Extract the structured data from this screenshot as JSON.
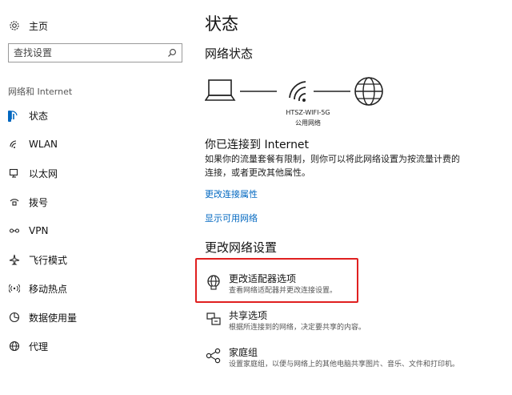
{
  "sidebar": {
    "home_label": "主页",
    "search_placeholder": "查找设置",
    "section_label": "网络和 Internet",
    "items": [
      {
        "label": "状态",
        "icon": "status-icon",
        "active": true
      },
      {
        "label": "WLAN",
        "icon": "wifi-icon"
      },
      {
        "label": "以太网",
        "icon": "ethernet-icon"
      },
      {
        "label": "拨号",
        "icon": "dialup-icon"
      },
      {
        "label": "VPN",
        "icon": "vpn-icon"
      },
      {
        "label": "飞行模式",
        "icon": "airplane-icon"
      },
      {
        "label": "移动热点",
        "icon": "hotspot-icon"
      },
      {
        "label": "数据使用量",
        "icon": "data-usage-icon"
      },
      {
        "label": "代理",
        "icon": "proxy-icon"
      }
    ]
  },
  "main": {
    "title": "状态",
    "network_status_title": "网络状态",
    "network": {
      "ssid": "HTSZ-WIFI-5G",
      "type": "公用网络"
    },
    "connected_title": "你已连接到 Internet",
    "connected_desc": "如果你的流量套餐有限制，则你可以将此网络设置为按流量计费的连接，或者更改其他属性。",
    "link_change_props": "更改连接属性",
    "link_show_networks": "显示可用网络",
    "change_settings_title": "更改网络设置",
    "options": [
      {
        "title": "更改适配器选项",
        "desc": "查看网络适配器并更改连接设置。",
        "icon": "adapter-icon"
      },
      {
        "title": "共享选项",
        "desc": "根据所连接到的网络，决定要共享的内容。",
        "icon": "sharing-icon"
      },
      {
        "title": "家庭组",
        "desc": "设置家庭组，以便与网络上的其他电脑共享图片、音乐、文件和打印机。",
        "icon": "homegroup-icon"
      }
    ]
  },
  "colors": {
    "accent": "#0067c0",
    "highlight": "#e02020"
  }
}
